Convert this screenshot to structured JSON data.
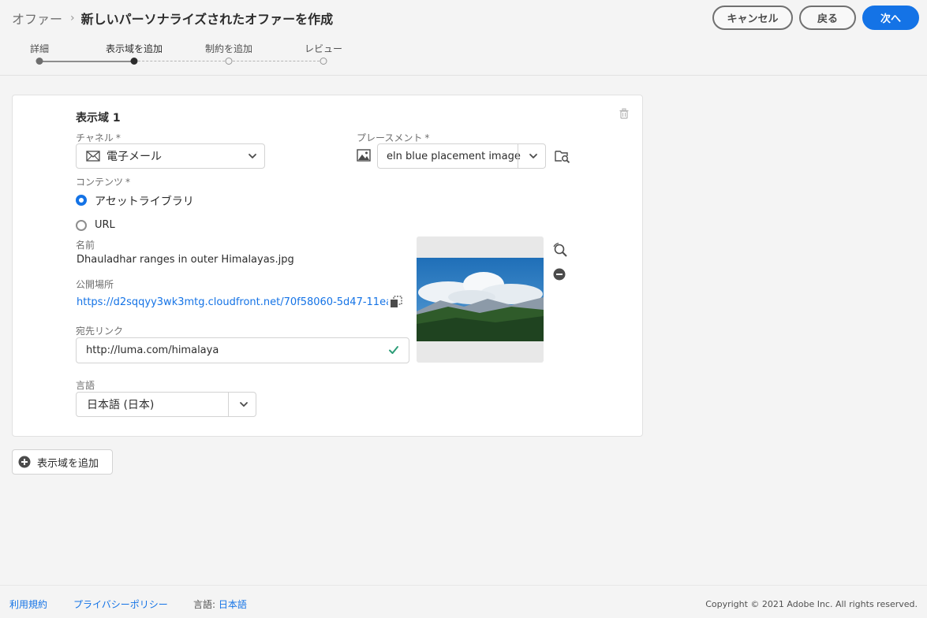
{
  "header": {
    "breadcrumb_root": "オファー",
    "breadcrumb_separator": "›",
    "title": "新しいパーソナライズされたオファーを作成",
    "cancel_label": "キャンセル",
    "back_label": "戻る",
    "next_label": "次へ",
    "accent_color": "#1473e6"
  },
  "steps": [
    {
      "label": "詳細",
      "state": "done"
    },
    {
      "label": "表示域を追加",
      "state": "current"
    },
    {
      "label": "制約を追加",
      "state": "future"
    },
    {
      "label": "レビュー",
      "state": "future"
    }
  ],
  "representation": {
    "title": "表示域 1",
    "channel_label": "チャネル",
    "channel_value": "電子メール",
    "placement_label": "プレースメント",
    "placement_value": "eln blue placement image",
    "required_mark": "*",
    "content_label": "コンテンツ",
    "content_options": [
      {
        "label": "アセットライブラリ",
        "selected": true
      },
      {
        "label": "URL",
        "selected": false
      }
    ],
    "name_label": "名前",
    "name_value": "Dhauladhar ranges in outer Himalayas.jpg",
    "public_location_label": "公開場所",
    "public_location_value": "https://d2sqqyy3wk3mtg.cloudfront.net/70f58060-5d47-11ea...",
    "destination_link_label": "宛先リンク",
    "destination_link_value": "http://luma.com/himalaya",
    "language_label": "言語",
    "language_value": "日本語 (日本)"
  },
  "add_representation_label": "表示域を追加",
  "footer": {
    "terms_label": "利用規約",
    "privacy_label": "プライバシーポリシー",
    "language_prefix": "言語:",
    "language_value": "日本語",
    "copyright": "Copyright ©  2021 Adobe Inc.  All rights reserved."
  },
  "icons": {
    "breadcrumb_separator": "chevron-right-icon",
    "trash": "delete-icon",
    "mail": "mail-icon",
    "placement": "image-icon",
    "browse": "folder-search-icon",
    "copy": "copy-icon",
    "zoom": "zoom-icon",
    "remove": "remove-circle-icon",
    "check": "checkmark-icon",
    "add": "add-circle-icon"
  }
}
